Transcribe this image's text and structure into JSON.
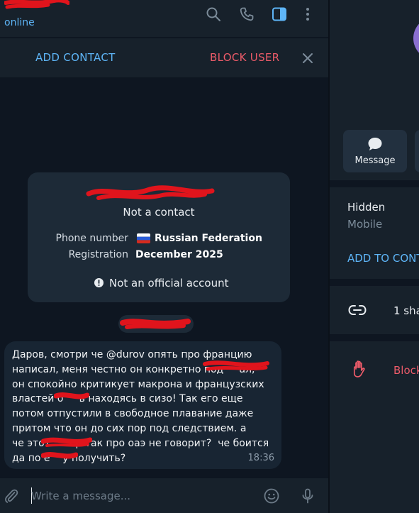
{
  "header": {
    "status": "online",
    "icons": [
      "search-icon",
      "phone-icon",
      "sidebar-toggle-icon",
      "more-vertical-icon"
    ]
  },
  "action_bar": {
    "add_contact_label": "ADD CONTACT",
    "block_user_label": "BLOCK USER"
  },
  "info_card": {
    "title": "Not a contact",
    "phone_label": "Phone number",
    "phone_value": "Russian Federation",
    "registration_label": "Registration",
    "registration_value": "December 2025",
    "notice": "Not an official account"
  },
  "message": {
    "text": "Даров, смотри че @durov опять про францию\nнаписал, меня честно он конкретно под     ал,\nон спокойно критикует макрона и французских\nвластей б     ь находясь в сизо! Так его еще\nпотом отпустили в свободное плавание даже\nпритом что он до сих пор под следствием. а\nче этот        р так про оаэ не говорит?  че боится\nда по е    у получить?",
    "time": "18:36"
  },
  "composer": {
    "placeholder": "Write a message..."
  },
  "side_panel": {
    "message_label": "Message",
    "phone_value": "Hidden",
    "phone_label": "Mobile",
    "add_to_contacts_label": "ADD TO CONT",
    "shared_links_label": "1 sha",
    "block_label": "Block"
  },
  "colors": {
    "background": "#0e1621",
    "panel": "#17212b",
    "bubble": "#182533",
    "accent": "#5eb5f7",
    "danger": "#ec5b69",
    "redaction": "#e0141c"
  }
}
